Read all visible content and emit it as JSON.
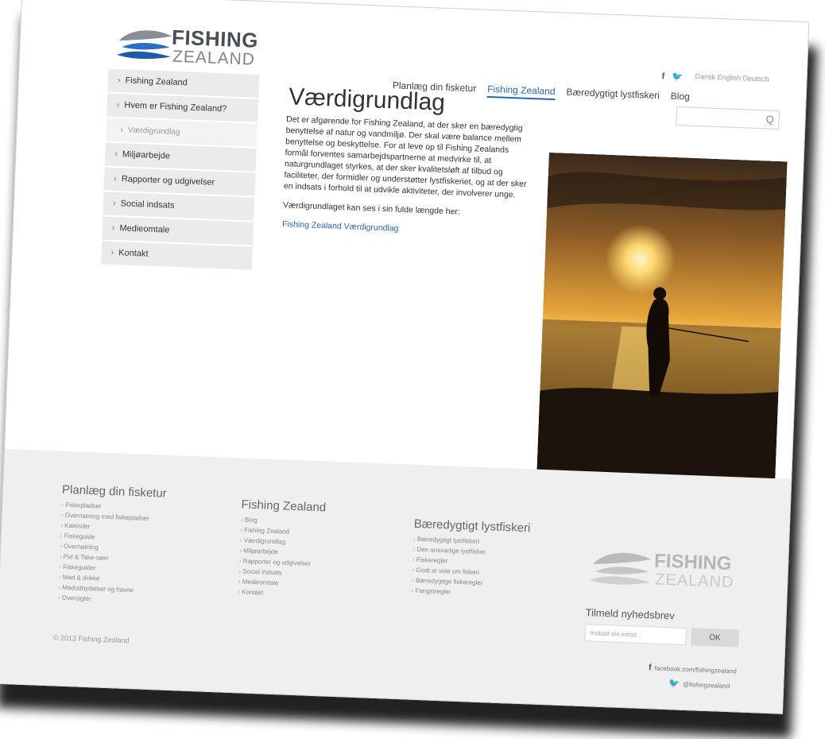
{
  "header": {
    "logo_line1": "FISHING",
    "logo_line2": "ZEALAND",
    "social": {
      "facebook_glyph": "f",
      "twitter_glyph": "🐦"
    },
    "languages": "Dansk  English  Deutsch",
    "nav": [
      "Planlæg din fisketur",
      "Fishing Zealand",
      "Bæredygtigt lystfiskeri",
      "Blog"
    ],
    "search_glyph": "Q"
  },
  "sidebar": {
    "items": [
      "Fishing Zealand",
      "Hvem er Fishing Zealand?",
      "Værdigrundlag",
      "Miljøarbejde",
      "Rapporter og udgivelser",
      "Social indsats",
      "Medieomtale",
      "Kontakt"
    ]
  },
  "main": {
    "title": "Værdigrundlag",
    "paragraph1": "Det er afgørende for Fishing Zealand, at der sker en bæredygtig benyttelse af natur og vandmiljø. Der skal være balance mellem benyttelse og beskyttelse. For at leve op til Fishing Zealands formål forventes samarbejdspartnerne at medvirke til, at naturgrundlaget styrkes, at der sker kvalitetsløft af tilbud og faciliteter, der formidler og understøtter lystfiskeriet, og at der sker en indsats i forhold til at udvikle aktiviteter, der involverer unge.",
    "paragraph2": "Værdigrundlaget kan ses i sin fulde længde her:",
    "link": "Fishing Zealand Værdigrundlag"
  },
  "footer": {
    "col1": {
      "title": "Planlæg din fisketur",
      "items": [
        "Fiskepladser",
        "Overnatning med fiskepladser",
        "Kalender",
        "Fiskeguide",
        "Overnatning",
        "Put & Take-søer",
        "Fiskeguider",
        "Mad & drikke",
        "Madudbydelser og havne",
        "Oversigter"
      ]
    },
    "col2": {
      "title": "Fishing Zealand",
      "items": [
        "Blog",
        "Fishing Zealand",
        "Værdigrundlag",
        "Miljøarbejde",
        "Rapporter og udgivelser",
        "Social indsats",
        "Medieomtale",
        "Kontakt"
      ]
    },
    "col3": {
      "title": "Bæredygtigt lystfiskeri",
      "items": [
        "Bæredygtigt lystfiskeri",
        "Den ansvarlige lystfisker",
        "Fiskeregler",
        "Godt at vide om fiskeri",
        "Bæredygtige fiskeregler",
        "Fangstregler"
      ]
    },
    "copyright": "© 2013 Fishing Zealand",
    "logo_line1": "FISHING",
    "logo_line2": "ZEALAND",
    "newsletter_title": "Tilmeld nyhedsbrev",
    "newsletter_placeholder": "Indtast din email...",
    "newsletter_button": "OK",
    "facebook_text": "facebook.com/fishingzealand",
    "twitter_text": "@fishingzealand"
  },
  "colors": {
    "accent": "#2a66b8",
    "sidebar_bg": "#ebebeb",
    "footer_bg": "#efefef"
  }
}
